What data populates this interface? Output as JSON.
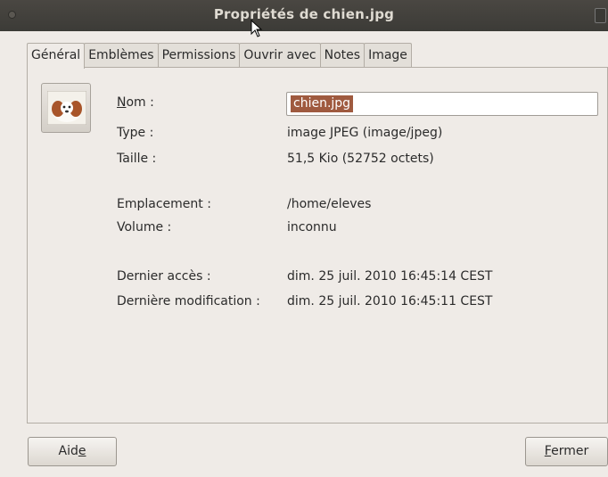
{
  "window": {
    "title": "Propriétés de chien.jpg"
  },
  "tabs": [
    {
      "label": "Général",
      "active": true
    },
    {
      "label": "Emblèmes",
      "active": false
    },
    {
      "label": "Permissions",
      "active": false
    },
    {
      "label": "Ouvrir avec",
      "active": false
    },
    {
      "label": "Notes",
      "active": false
    },
    {
      "label": "Image",
      "active": false
    }
  ],
  "general": {
    "thumbnail_icon": "dog-image-thumbnail-icon",
    "name_label_mnemonic": "N",
    "name_label_rest": "om :",
    "name_value": "chien.jpg",
    "type_label": "Type :",
    "type_value": "image JPEG (image/jpeg)",
    "size_label": "Taille :",
    "size_value": "51,5 Kio (52752 octets)",
    "location_label": "Emplacement :",
    "location_value": "/home/eleves",
    "volume_label": "Volume :",
    "volume_value": "inconnu",
    "accessed_label": "Dernier accès :",
    "accessed_value": "dim. 25 juil. 2010 16:45:14 CEST",
    "modified_label": "Dernière modification :",
    "modified_value": "dim. 25 juil. 2010 16:45:11 CEST"
  },
  "buttons": {
    "help_prefix": "Aid",
    "help_mnemonic": "e",
    "close_mnemonic": "F",
    "close_rest": "ermer"
  },
  "colors": {
    "titlebar": "#3c3b37",
    "selection": "#9f5a3f",
    "window_bg": "#efebe7"
  }
}
